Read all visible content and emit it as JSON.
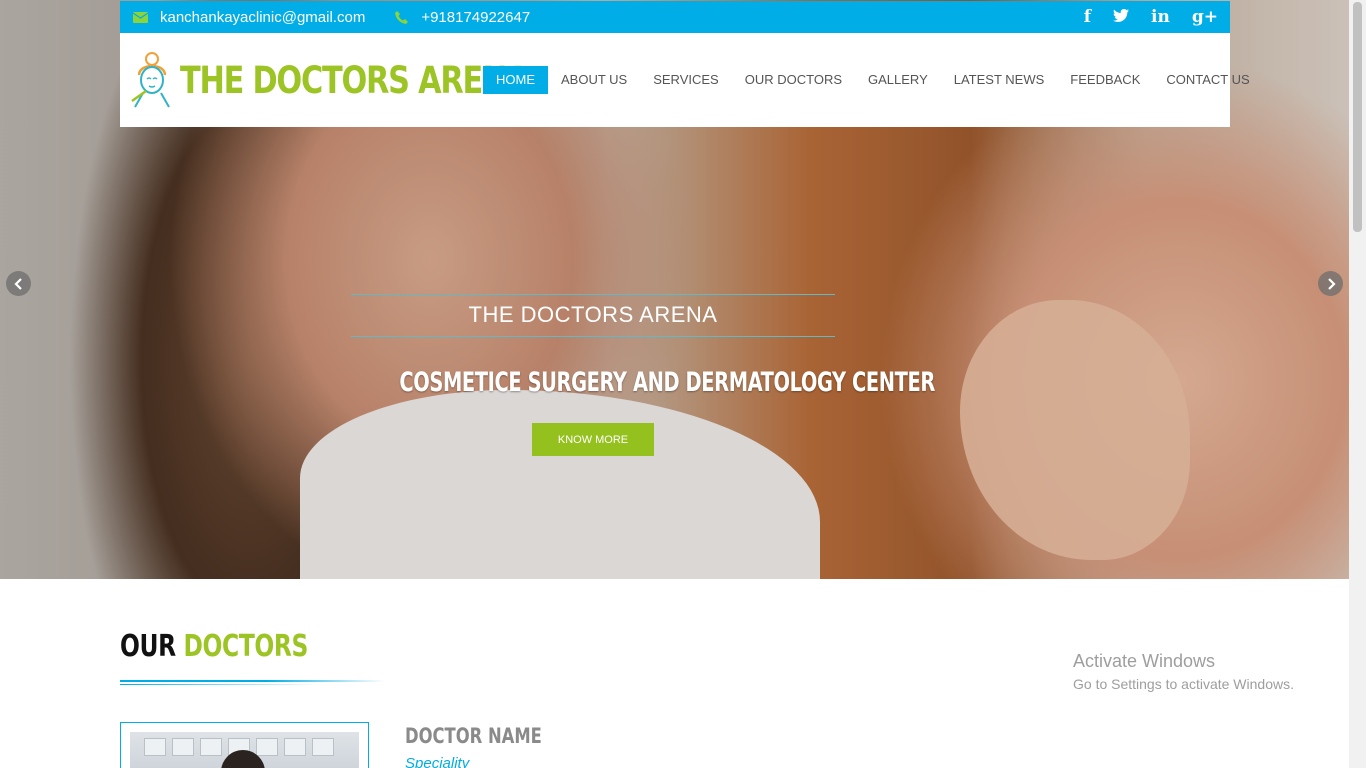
{
  "topbar": {
    "email": "kanchankayaclinic@gmail.com",
    "phone": "+918174922647",
    "email_icon": "envelope-icon",
    "phone_icon": "phone-icon",
    "social": [
      {
        "icon": "facebook-icon",
        "glyph": "f"
      },
      {
        "icon": "twitter-icon",
        "glyph": "t"
      },
      {
        "icon": "linkedin-icon",
        "glyph": "in"
      },
      {
        "icon": "google-plus-icon",
        "glyph": "g+"
      }
    ]
  },
  "brand": {
    "name": "THE DOCTORS ARENA",
    "accent_green": "#9dc425",
    "accent_blue": "#00ade6"
  },
  "nav": {
    "items": [
      "HOME",
      "ABOUT US",
      "SERVICES",
      "OUR DOCTORS",
      "GALLERY",
      "LATEST NEWS",
      "FEEDBACK",
      "CONTACT US"
    ],
    "active": "HOME"
  },
  "slide": {
    "brand": "THE DOCTORS ARENA",
    "headline": "COSMETICE SURGERY AND DERMATOLOGY CENTER",
    "button": "KNOW MORE"
  },
  "doctors": {
    "title_part1": "OUR",
    "title_part2": "DOCTORS",
    "name": "DOCTOR NAME",
    "speciality": "Speciality"
  },
  "watermark": {
    "line1": "Activate Windows",
    "line2": "Go to Settings to activate Windows."
  }
}
